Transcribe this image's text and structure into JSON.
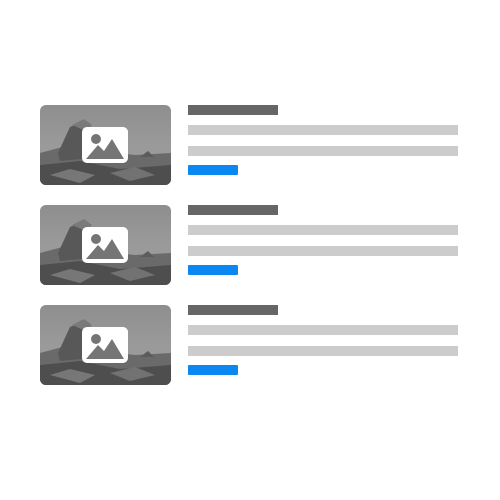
{
  "colors": {
    "background": "#ffffff",
    "title_placeholder": "#666666",
    "text_placeholder": "#cccccc",
    "link_placeholder": "#0a87f0",
    "image_badge": "#ffffff"
  },
  "list": {
    "items": [
      {
        "thumbnail_icon": "image-placeholder-icon"
      },
      {
        "thumbnail_icon": "image-placeholder-icon"
      },
      {
        "thumbnail_icon": "image-placeholder-icon"
      }
    ]
  }
}
